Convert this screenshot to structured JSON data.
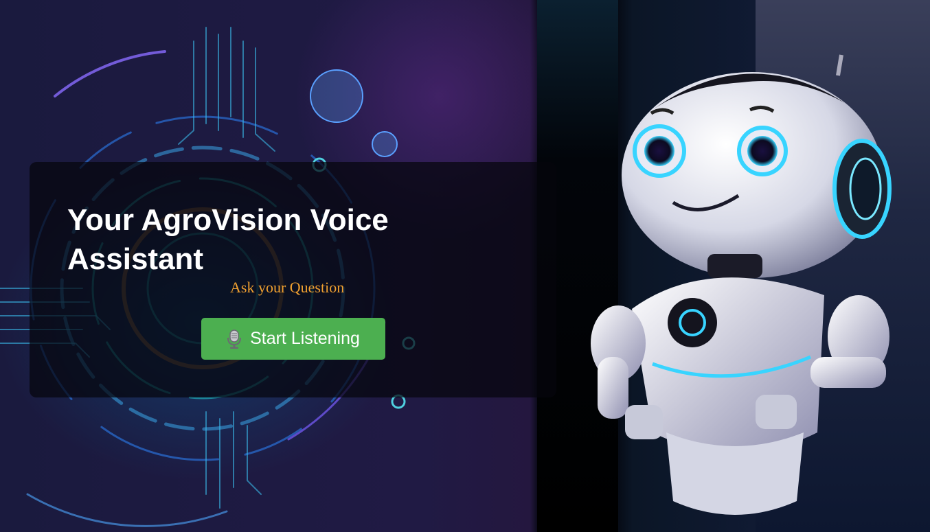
{
  "hero": {
    "title": "Your AgroVision Voice Assistant",
    "subtitle": "Ask your Question",
    "button_label": "Start Listening",
    "button_icon": "microphone-icon",
    "button_color": "#4caf50",
    "subtitle_color": "#f0a030"
  },
  "background": {
    "illustration": "circuit-board-illustration",
    "robot": "robot-illustration"
  }
}
